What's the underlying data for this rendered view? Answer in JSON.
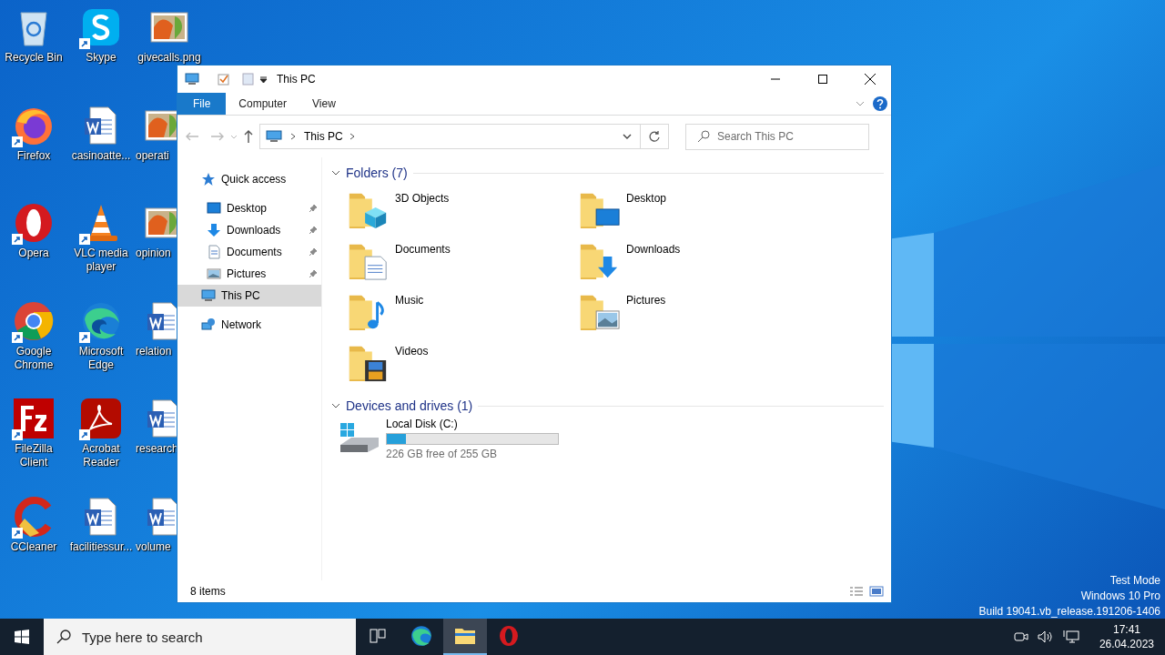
{
  "desktop": {
    "icons": [
      {
        "label": "Recycle Bin",
        "kind": "recycle",
        "shortcut": false
      },
      {
        "label": "Skype",
        "kind": "skype",
        "shortcut": true
      },
      {
        "label": "givecalls.png",
        "kind": "image",
        "shortcut": false
      },
      {
        "label": "Firefox",
        "kind": "firefox",
        "shortcut": true
      },
      {
        "label": "casinoatte...",
        "kind": "word",
        "shortcut": false
      },
      {
        "label": "operati",
        "kind": "image",
        "shortcut": false
      },
      {
        "label": "Opera",
        "kind": "opera",
        "shortcut": true
      },
      {
        "label": "VLC media player",
        "kind": "vlc",
        "shortcut": true
      },
      {
        "label": "opinion",
        "kind": "image",
        "shortcut": false
      },
      {
        "label": "Google Chrome",
        "kind": "chrome",
        "shortcut": true
      },
      {
        "label": "Microsoft Edge",
        "kind": "edge",
        "shortcut": true
      },
      {
        "label": "relation",
        "kind": "word",
        "shortcut": false
      },
      {
        "label": "FileZilla Client",
        "kind": "filezilla",
        "shortcut": true
      },
      {
        "label": "Acrobat Reader",
        "kind": "acrobat",
        "shortcut": true
      },
      {
        "label": "research",
        "kind": "word",
        "shortcut": false
      },
      {
        "label": "CCleaner",
        "kind": "ccleaner",
        "shortcut": true
      },
      {
        "label": "facilitiessur...",
        "kind": "word",
        "shortcut": false
      },
      {
        "label": "volume",
        "kind": "word",
        "shortcut": false
      }
    ],
    "system_text": [
      "Test Mode",
      "Windows 10 Pro",
      "Build 19041.vb_release.191206-1406"
    ]
  },
  "window": {
    "title": "This PC",
    "ribbon_tabs": [
      {
        "label": "File",
        "kind": "file"
      },
      {
        "label": "Computer",
        "kind": "tab"
      },
      {
        "label": "View",
        "kind": "tab"
      }
    ],
    "address": [
      "This PC"
    ],
    "search": {
      "placeholder": "Search This PC"
    },
    "navigation": [
      {
        "label": "Quick access",
        "kind": "star",
        "selected": false,
        "children": [
          {
            "label": "Desktop",
            "kind": "desktop",
            "selected": false,
            "pinned": true
          },
          {
            "label": "Downloads",
            "kind": "downloads",
            "selected": false,
            "pinned": true
          },
          {
            "label": "Documents",
            "kind": "documents",
            "selected": false,
            "pinned": true
          },
          {
            "label": "Pictures",
            "kind": "pictures",
            "selected": false,
            "pinned": true
          }
        ]
      },
      {
        "label": "This PC",
        "kind": "pc",
        "selected": true
      },
      {
        "label": "Network",
        "kind": "network",
        "selected": false
      }
    ],
    "folders": {
      "title": "Folders (7)",
      "expanded": true,
      "items": [
        {
          "label": "3D Objects",
          "kind": "objects3d"
        },
        {
          "label": "Desktop",
          "kind": "desktop"
        },
        {
          "label": "Documents",
          "kind": "documents"
        },
        {
          "label": "Downloads",
          "kind": "downloads"
        },
        {
          "label": "Music",
          "kind": "music"
        },
        {
          "label": "Pictures",
          "kind": "pictures"
        },
        {
          "label": "Videos",
          "kind": "videos"
        }
      ]
    },
    "drives": {
      "title": "Devices and drives (1)",
      "expanded": true,
      "items": [
        {
          "label": "Local Disk (C:)",
          "level": 0.11,
          "free": "226 GB free of 255 GB"
        }
      ]
    },
    "status_bar": "8 items"
  },
  "taskbar": {
    "search": {
      "placeholder": "Type here to search"
    },
    "apps": [
      {
        "kind": "taskview",
        "selected": false
      },
      {
        "kind": "edge",
        "selected": false
      },
      {
        "kind": "explorer",
        "selected": true
      },
      {
        "kind": "opera",
        "selected": false
      }
    ],
    "time": "17:41",
    "date": "26.04.2023"
  }
}
